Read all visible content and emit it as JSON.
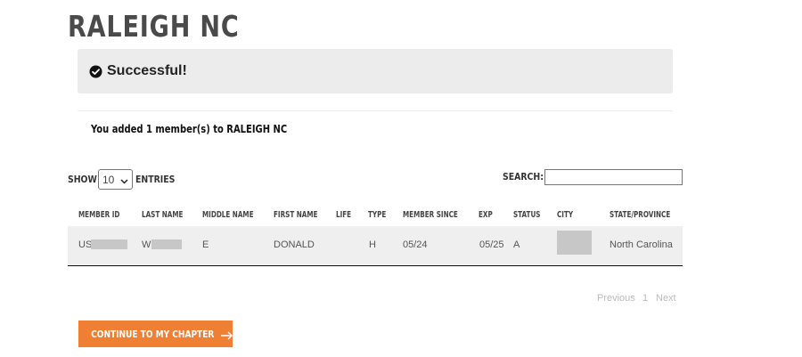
{
  "page": {
    "title": "RALEIGH NC"
  },
  "alert": {
    "icon": "check-circle-icon",
    "message": "Successful!"
  },
  "confirmation": {
    "message": "You added 1 member(s) to RALEIGH NC"
  },
  "table_controls": {
    "show_label": "SHOW",
    "page_length": "10",
    "entries_label": "ENTRIES",
    "search_label": "SEARCH:",
    "search_value": ""
  },
  "table": {
    "columns": [
      "MEMBER ID",
      "LAST NAME",
      "MIDDLE NAME",
      "FIRST NAME",
      "LIFE",
      "TYPE",
      "MEMBER SINCE",
      "EXP",
      "STATUS",
      "CITY",
      "STATE/PROVINCE"
    ],
    "rows": [
      {
        "member_id": "US",
        "last_name": "W",
        "middle_name": "E",
        "first_name": "DONALD",
        "life": "",
        "type": "H",
        "member_since": "05/24",
        "exp": "05/25",
        "status": "A",
        "city": "",
        "state": "North Carolina"
      }
    ]
  },
  "pagination": {
    "previous": "Previous",
    "current": "1",
    "next": "Next"
  },
  "continue_button": {
    "label": "CONTINUE TO MY CHAPTER",
    "icon": "arrow-right-icon",
    "color": "#ee7f33"
  }
}
